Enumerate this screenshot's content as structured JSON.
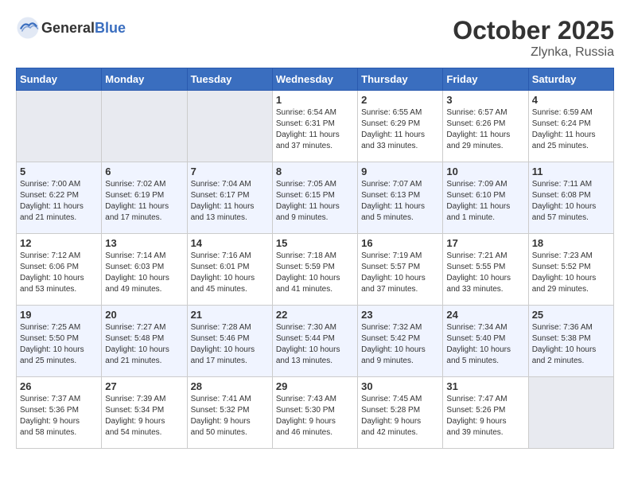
{
  "header": {
    "logo_general": "General",
    "logo_blue": "Blue",
    "month_year": "October 2025",
    "location": "Zlynka, Russia"
  },
  "weekdays": [
    "Sunday",
    "Monday",
    "Tuesday",
    "Wednesday",
    "Thursday",
    "Friday",
    "Saturday"
  ],
  "weeks": [
    [
      {
        "day": "",
        "info": ""
      },
      {
        "day": "",
        "info": ""
      },
      {
        "day": "",
        "info": ""
      },
      {
        "day": "1",
        "info": "Sunrise: 6:54 AM\nSunset: 6:31 PM\nDaylight: 11 hours\nand 37 minutes."
      },
      {
        "day": "2",
        "info": "Sunrise: 6:55 AM\nSunset: 6:29 PM\nDaylight: 11 hours\nand 33 minutes."
      },
      {
        "day": "3",
        "info": "Sunrise: 6:57 AM\nSunset: 6:26 PM\nDaylight: 11 hours\nand 29 minutes."
      },
      {
        "day": "4",
        "info": "Sunrise: 6:59 AM\nSunset: 6:24 PM\nDaylight: 11 hours\nand 25 minutes."
      }
    ],
    [
      {
        "day": "5",
        "info": "Sunrise: 7:00 AM\nSunset: 6:22 PM\nDaylight: 11 hours\nand 21 minutes."
      },
      {
        "day": "6",
        "info": "Sunrise: 7:02 AM\nSunset: 6:19 PM\nDaylight: 11 hours\nand 17 minutes."
      },
      {
        "day": "7",
        "info": "Sunrise: 7:04 AM\nSunset: 6:17 PM\nDaylight: 11 hours\nand 13 minutes."
      },
      {
        "day": "8",
        "info": "Sunrise: 7:05 AM\nSunset: 6:15 PM\nDaylight: 11 hours\nand 9 minutes."
      },
      {
        "day": "9",
        "info": "Sunrise: 7:07 AM\nSunset: 6:13 PM\nDaylight: 11 hours\nand 5 minutes."
      },
      {
        "day": "10",
        "info": "Sunrise: 7:09 AM\nSunset: 6:10 PM\nDaylight: 11 hours\nand 1 minute."
      },
      {
        "day": "11",
        "info": "Sunrise: 7:11 AM\nSunset: 6:08 PM\nDaylight: 10 hours\nand 57 minutes."
      }
    ],
    [
      {
        "day": "12",
        "info": "Sunrise: 7:12 AM\nSunset: 6:06 PM\nDaylight: 10 hours\nand 53 minutes."
      },
      {
        "day": "13",
        "info": "Sunrise: 7:14 AM\nSunset: 6:03 PM\nDaylight: 10 hours\nand 49 minutes."
      },
      {
        "day": "14",
        "info": "Sunrise: 7:16 AM\nSunset: 6:01 PM\nDaylight: 10 hours\nand 45 minutes."
      },
      {
        "day": "15",
        "info": "Sunrise: 7:18 AM\nSunset: 5:59 PM\nDaylight: 10 hours\nand 41 minutes."
      },
      {
        "day": "16",
        "info": "Sunrise: 7:19 AM\nSunset: 5:57 PM\nDaylight: 10 hours\nand 37 minutes."
      },
      {
        "day": "17",
        "info": "Sunrise: 7:21 AM\nSunset: 5:55 PM\nDaylight: 10 hours\nand 33 minutes."
      },
      {
        "day": "18",
        "info": "Sunrise: 7:23 AM\nSunset: 5:52 PM\nDaylight: 10 hours\nand 29 minutes."
      }
    ],
    [
      {
        "day": "19",
        "info": "Sunrise: 7:25 AM\nSunset: 5:50 PM\nDaylight: 10 hours\nand 25 minutes."
      },
      {
        "day": "20",
        "info": "Sunrise: 7:27 AM\nSunset: 5:48 PM\nDaylight: 10 hours\nand 21 minutes."
      },
      {
        "day": "21",
        "info": "Sunrise: 7:28 AM\nSunset: 5:46 PM\nDaylight: 10 hours\nand 17 minutes."
      },
      {
        "day": "22",
        "info": "Sunrise: 7:30 AM\nSunset: 5:44 PM\nDaylight: 10 hours\nand 13 minutes."
      },
      {
        "day": "23",
        "info": "Sunrise: 7:32 AM\nSunset: 5:42 PM\nDaylight: 10 hours\nand 9 minutes."
      },
      {
        "day": "24",
        "info": "Sunrise: 7:34 AM\nSunset: 5:40 PM\nDaylight: 10 hours\nand 5 minutes."
      },
      {
        "day": "25",
        "info": "Sunrise: 7:36 AM\nSunset: 5:38 PM\nDaylight: 10 hours\nand 2 minutes."
      }
    ],
    [
      {
        "day": "26",
        "info": "Sunrise: 7:37 AM\nSunset: 5:36 PM\nDaylight: 9 hours\nand 58 minutes."
      },
      {
        "day": "27",
        "info": "Sunrise: 7:39 AM\nSunset: 5:34 PM\nDaylight: 9 hours\nand 54 minutes."
      },
      {
        "day": "28",
        "info": "Sunrise: 7:41 AM\nSunset: 5:32 PM\nDaylight: 9 hours\nand 50 minutes."
      },
      {
        "day": "29",
        "info": "Sunrise: 7:43 AM\nSunset: 5:30 PM\nDaylight: 9 hours\nand 46 minutes."
      },
      {
        "day": "30",
        "info": "Sunrise: 7:45 AM\nSunset: 5:28 PM\nDaylight: 9 hours\nand 42 minutes."
      },
      {
        "day": "31",
        "info": "Sunrise: 7:47 AM\nSunset: 5:26 PM\nDaylight: 9 hours\nand 39 minutes."
      },
      {
        "day": "",
        "info": ""
      }
    ]
  ]
}
